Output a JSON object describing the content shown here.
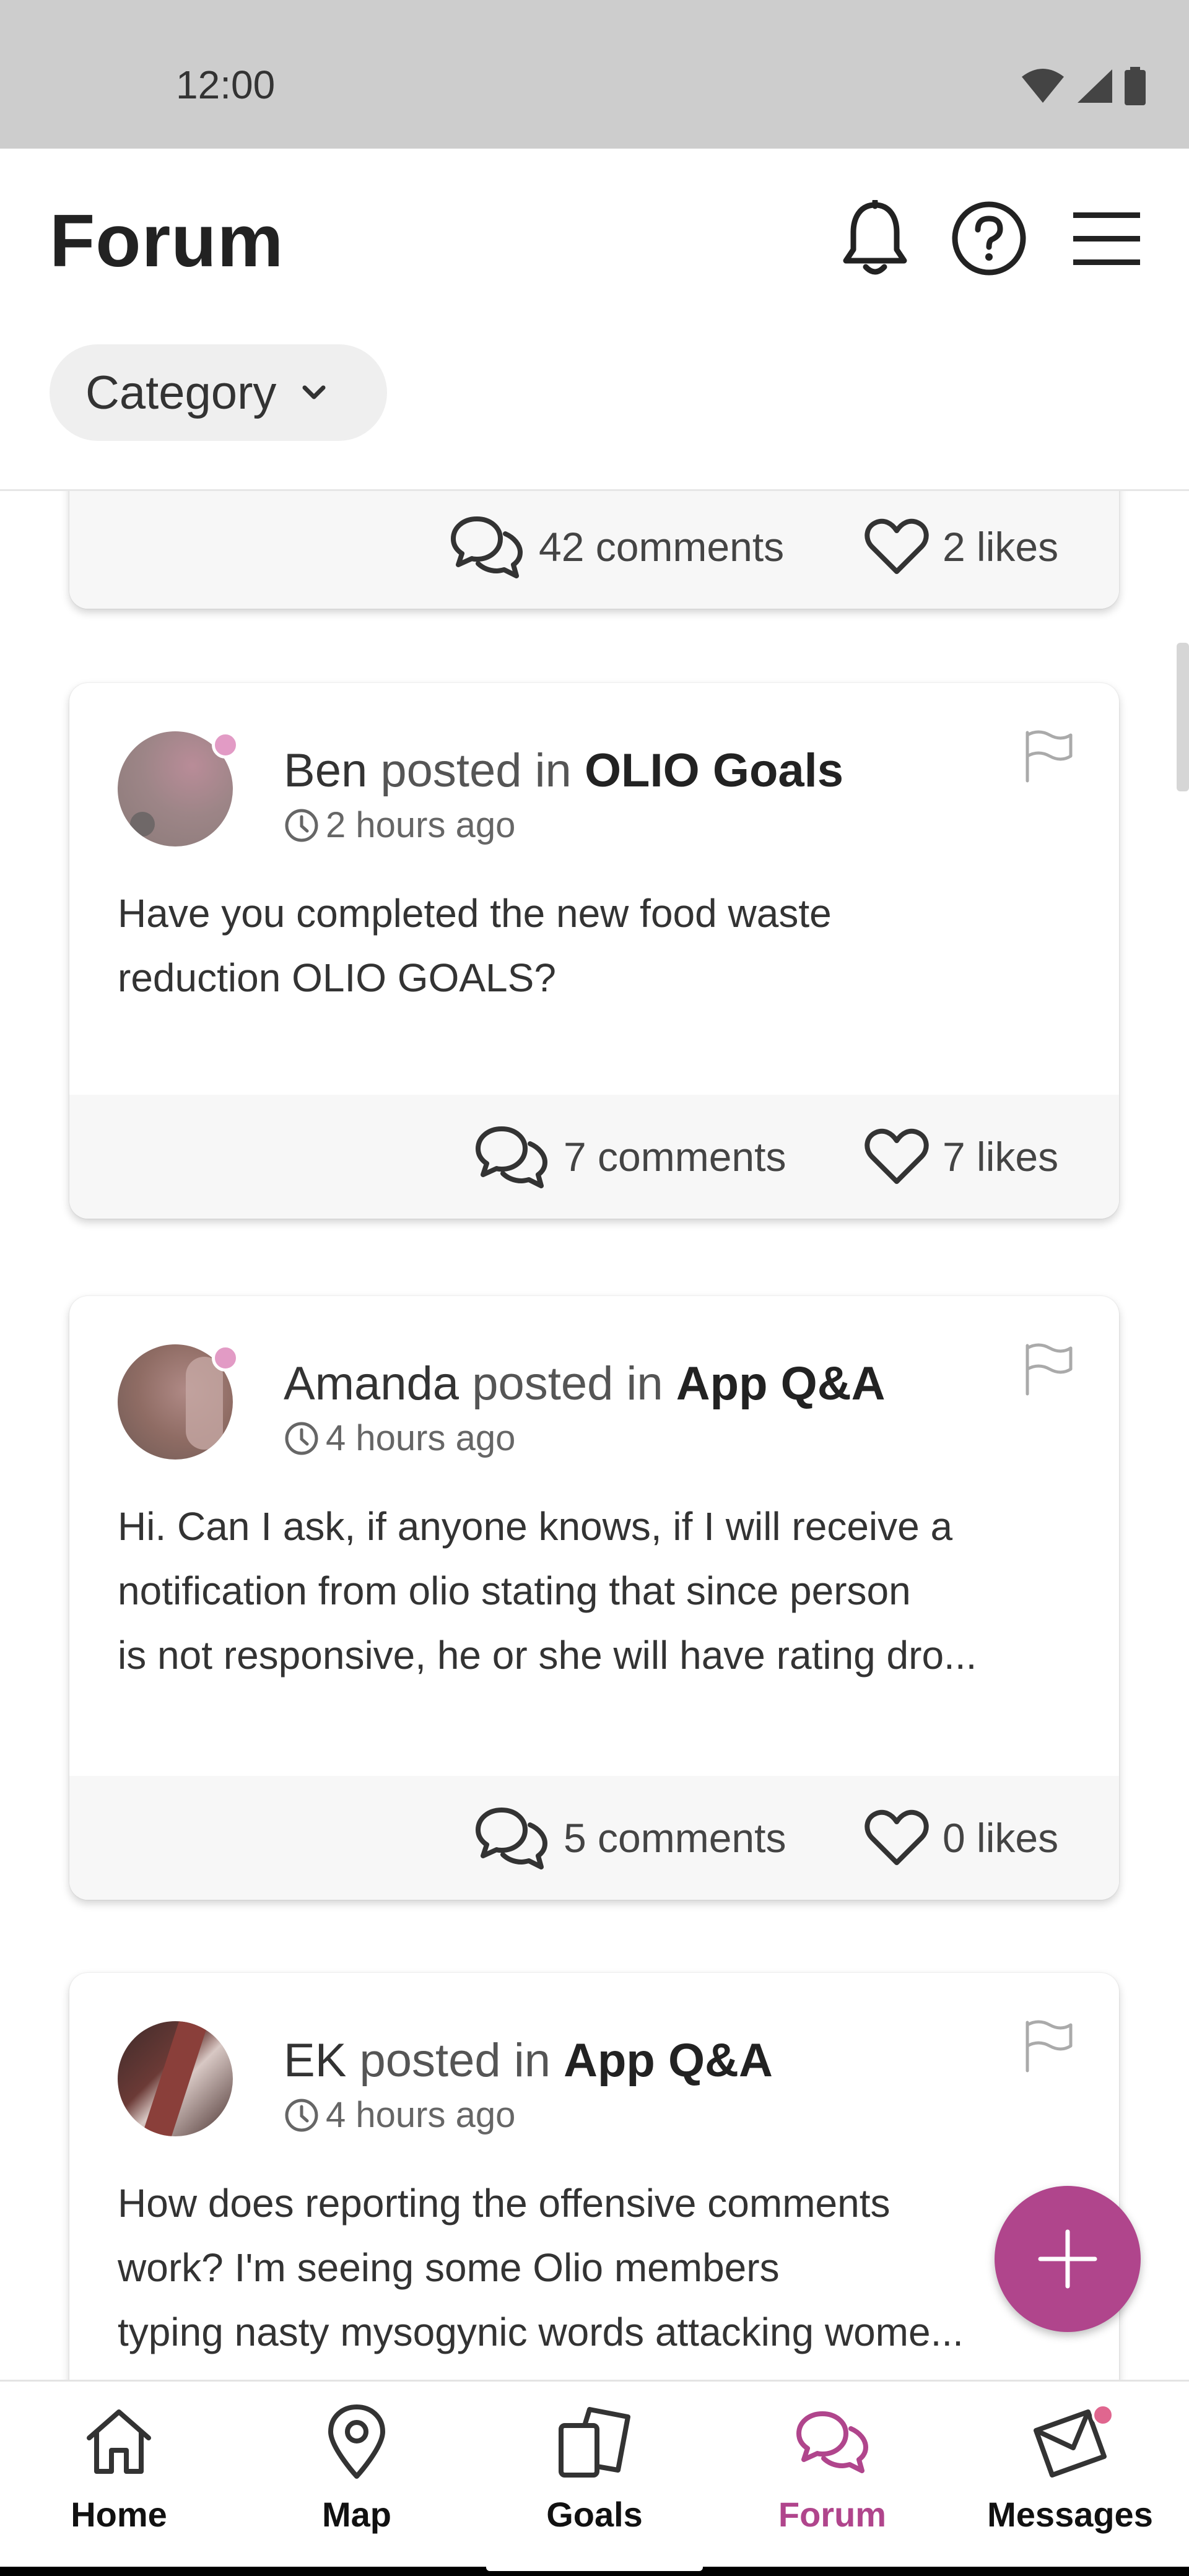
{
  "status_bar": {
    "time": "12:00"
  },
  "header": {
    "title": "Forum",
    "category_label": "Category"
  },
  "colors": {
    "accent": "#b0458c",
    "status_bar_bg": "#cdcdcd",
    "footer_bg": "#f7f7f7"
  },
  "partial_post": {
    "comments": "42 comments",
    "likes": "2 likes"
  },
  "posts": [
    {
      "author": "Ben",
      "posted_in": "posted in",
      "category": "OLIO Goals",
      "time": "2 hours ago",
      "body": [
        "Have you completed the new food waste",
        "reduction OLIO GOALS?"
      ],
      "comments": "7 comments",
      "likes": "7 likes"
    },
    {
      "author": "Amanda",
      "posted_in": "posted in",
      "category": "App Q&A",
      "time": "4 hours ago",
      "body": [
        "Hi. Can I ask, if anyone knows, if I will receive a",
        "notification from olio stating that since person",
        "is not responsive, he or she will have rating dro..."
      ],
      "comments": "5 comments",
      "likes": "0 likes"
    },
    {
      "author": "EK",
      "posted_in": "posted in",
      "category": "App Q&A",
      "time": "4 hours ago",
      "body": [
        "How does reporting the offensive comments",
        "work? I'm seeing some Olio members",
        "typing nasty mysogynic words attacking wome..."
      ]
    }
  ],
  "bottom_nav": [
    {
      "label": "Home",
      "icon": "home-icon"
    },
    {
      "label": "Map",
      "icon": "map-pin-icon"
    },
    {
      "label": "Goals",
      "icon": "goals-icon"
    },
    {
      "label": "Forum",
      "icon": "forum-icon",
      "active": true
    },
    {
      "label": "Messages",
      "icon": "messages-icon"
    }
  ]
}
